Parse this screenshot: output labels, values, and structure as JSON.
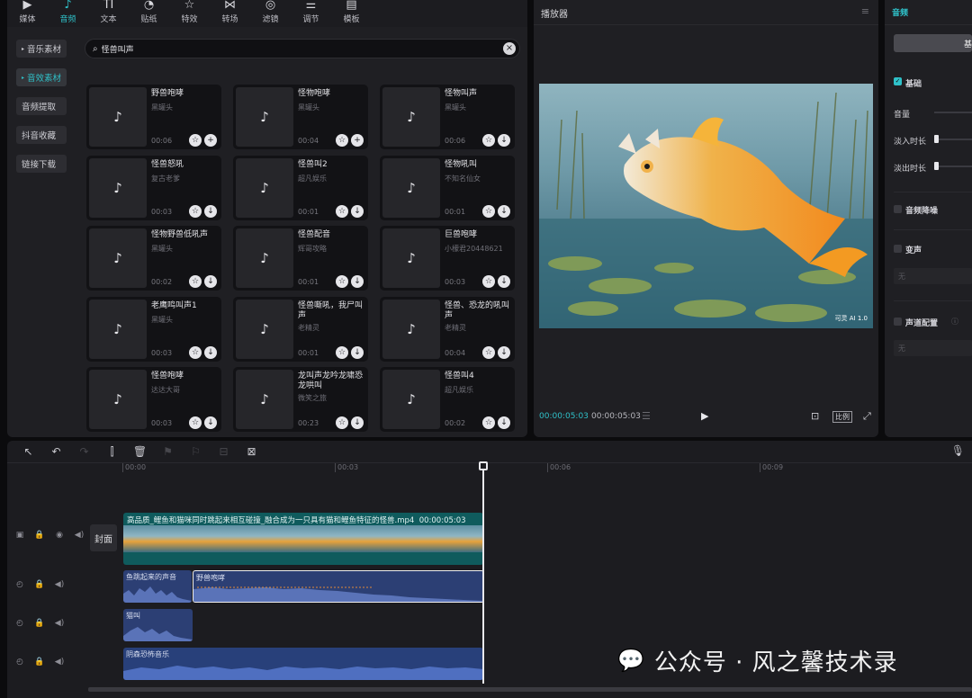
{
  "top_tabs": [
    {
      "label": "媒体",
      "icon": "media-icon",
      "glyph": "▶"
    },
    {
      "label": "音频",
      "icon": "audio-icon",
      "glyph": "♪",
      "active": true
    },
    {
      "label": "文本",
      "icon": "text-icon",
      "glyph": "TI"
    },
    {
      "label": "贴纸",
      "icon": "sticker-icon",
      "glyph": "◔"
    },
    {
      "label": "特效",
      "icon": "effects-icon",
      "glyph": "☆"
    },
    {
      "label": "转场",
      "icon": "transition-icon",
      "glyph": "⋈"
    },
    {
      "label": "滤镜",
      "icon": "filter-icon",
      "glyph": "◎"
    },
    {
      "label": "调节",
      "icon": "adjust-icon",
      "glyph": "⚌"
    },
    {
      "label": "模板",
      "icon": "template-icon",
      "glyph": "▤"
    }
  ],
  "sidebar": {
    "items": [
      {
        "label": "音乐素材",
        "expandable": true
      },
      {
        "label": "音效素材",
        "expandable": true,
        "active": true
      },
      {
        "label": "音频提取"
      },
      {
        "label": "抖音收藏"
      },
      {
        "label": "链接下载"
      }
    ]
  },
  "search": {
    "value": "怪兽叫声"
  },
  "sounds": [
    {
      "title": "野兽咆哮",
      "author": "黑罐头",
      "duration": "00:06",
      "action": "+"
    },
    {
      "title": "怪物咆哮",
      "author": "黑罐头",
      "duration": "00:04",
      "action": "+"
    },
    {
      "title": "怪物叫声",
      "author": "黑罐头",
      "duration": "00:06",
      "action": "↓"
    },
    {
      "title": "怪兽怒吼",
      "author": "复古老爹",
      "duration": "00:03",
      "action": "↓"
    },
    {
      "title": "怪兽叫2",
      "author": "超凡娱乐",
      "duration": "00:01",
      "action": "↓"
    },
    {
      "title": "怪物吼叫",
      "author": "不知名仙女",
      "duration": "00:01",
      "action": "↓"
    },
    {
      "title": "怪物野兽低吼声",
      "author": "黑罐头",
      "duration": "00:02",
      "action": "↓"
    },
    {
      "title": "怪兽配音",
      "author": "辉哥攻略",
      "duration": "00:01",
      "action": "↓"
    },
    {
      "title": "巨兽咆哮",
      "author": "小檬君20448621",
      "duration": "00:03",
      "action": "↓"
    },
    {
      "title": "老鹰鸣叫声1",
      "author": "黑罐头",
      "duration": "00:03",
      "action": "↓"
    },
    {
      "title": "怪兽嘶吼，我尸叫声",
      "author": "老精灵",
      "duration": "00:01",
      "action": "↓"
    },
    {
      "title": "怪兽、恐龙的吼叫声",
      "author": "老精灵",
      "duration": "00:04",
      "action": "↓"
    },
    {
      "title": "怪兽咆哮",
      "author": "达达大哥",
      "duration": "00:03",
      "action": "↓"
    },
    {
      "title": "龙叫声龙吟龙啸恐龙哄叫",
      "author": "微笑之旅",
      "duration": "00:23",
      "action": "↓"
    },
    {
      "title": "怪兽叫4",
      "author": "超凡娱乐",
      "duration": "00:02",
      "action": "↓"
    }
  ],
  "player": {
    "title": "播放器",
    "current_time": "00:00:05:03",
    "total_time": "00:00:05:03",
    "ratio_label": "比例",
    "watermark": "可灵 AI 1.0"
  },
  "right_panel": {
    "title": "音频",
    "tab_label": "基",
    "basic_label": "基础",
    "volume_label": "音量",
    "fade_in_label": "淡入时长",
    "fade_out_label": "淡出时长",
    "denoise_label": "音频降噪",
    "voice_change_label": "变声",
    "voice_change_value": "无",
    "channel_label": "声道配置",
    "channel_value": "无"
  },
  "timeline": {
    "ruler": [
      "00:00",
      "00:03",
      "00:06",
      "00:09"
    ],
    "cover_label": "封面",
    "video_clip": {
      "label": "高品质_鲤鱼和猫咪同时跳起来相互碰撞_融合成为一只具有猫和鲤鱼特征的怪兽.mp4",
      "duration": "00:00:05:03"
    },
    "audio_clips": [
      {
        "label": "鱼跳起来的声音"
      },
      {
        "label": "野兽咆哮"
      },
      {
        "label": "猫叫"
      },
      {
        "label": "阴森恐怖音乐"
      }
    ]
  },
  "colors": {
    "accent": "#2fc1c9",
    "panel": "#1f1f23",
    "video_clip": "#0f5b5d",
    "audio_clip": "#2c3f74"
  },
  "overlay_watermark": "公众号 · 风之馨技术录"
}
